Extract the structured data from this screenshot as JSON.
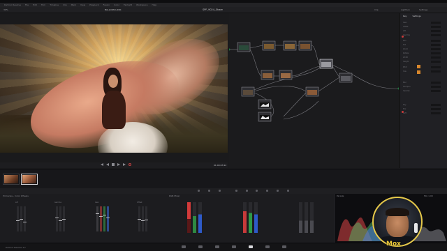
{
  "window": {
    "title": "DaVinci Resolve Studio - SPF_9024_Share"
  },
  "menubar": {
    "items": [
      "DaVinci Resolve",
      "File",
      "Edit",
      "Trim",
      "Timeline",
      "Clip",
      "Mark",
      "View",
      "Playback",
      "Fusion",
      "Color",
      "Fairlight",
      "Workspace",
      "Help"
    ]
  },
  "toolbar": {
    "zoom": "39%",
    "clip_name": "BALLOON LOOK",
    "project": "SPF_9024_Share",
    "right_tabs": [
      "Clip",
      "Lightbox",
      "Settings"
    ]
  },
  "viewer": {
    "timecode": "01:00:03:12"
  },
  "nodegraph": {
    "nodes": [
      "01",
      "02",
      "03",
      "04",
      "05",
      "06",
      "07",
      "08",
      "09",
      "10",
      "11"
    ]
  },
  "inspector": {
    "tabs": [
      "Key",
      "Settings"
    ],
    "rows": [
      "Gain",
      "Offset",
      "Lift",
      "Gamma",
      "Pan",
      "Tilt",
      "Zoom",
      "Rotate",
      "Width",
      "Height",
      "Pitch",
      "Yaw",
      "Blur",
      "Sharpen",
      "Opacity",
      "Key",
      "Mix",
      "Soft"
    ]
  },
  "bottom": {
    "primaries_title": "Primaries - Color Wheels",
    "wheels": [
      "Lift",
      "Gamma",
      "Gain",
      "Offset"
    ],
    "rgb_mixer_title": "RGB Mixer",
    "rgb_groups": [
      "Red Output",
      "Green Output",
      "Blue Output"
    ],
    "scope_title": "Parade",
    "scope_right": "Mix 1.00"
  },
  "pagebar": {
    "app_name": "DaVinci Resolve 17",
    "pages": [
      "media",
      "cut",
      "edit",
      "fusion",
      "color",
      "fairlight",
      "deliver"
    ],
    "active_page": "color"
  },
  "webcam": {
    "caption": "Mox"
  }
}
